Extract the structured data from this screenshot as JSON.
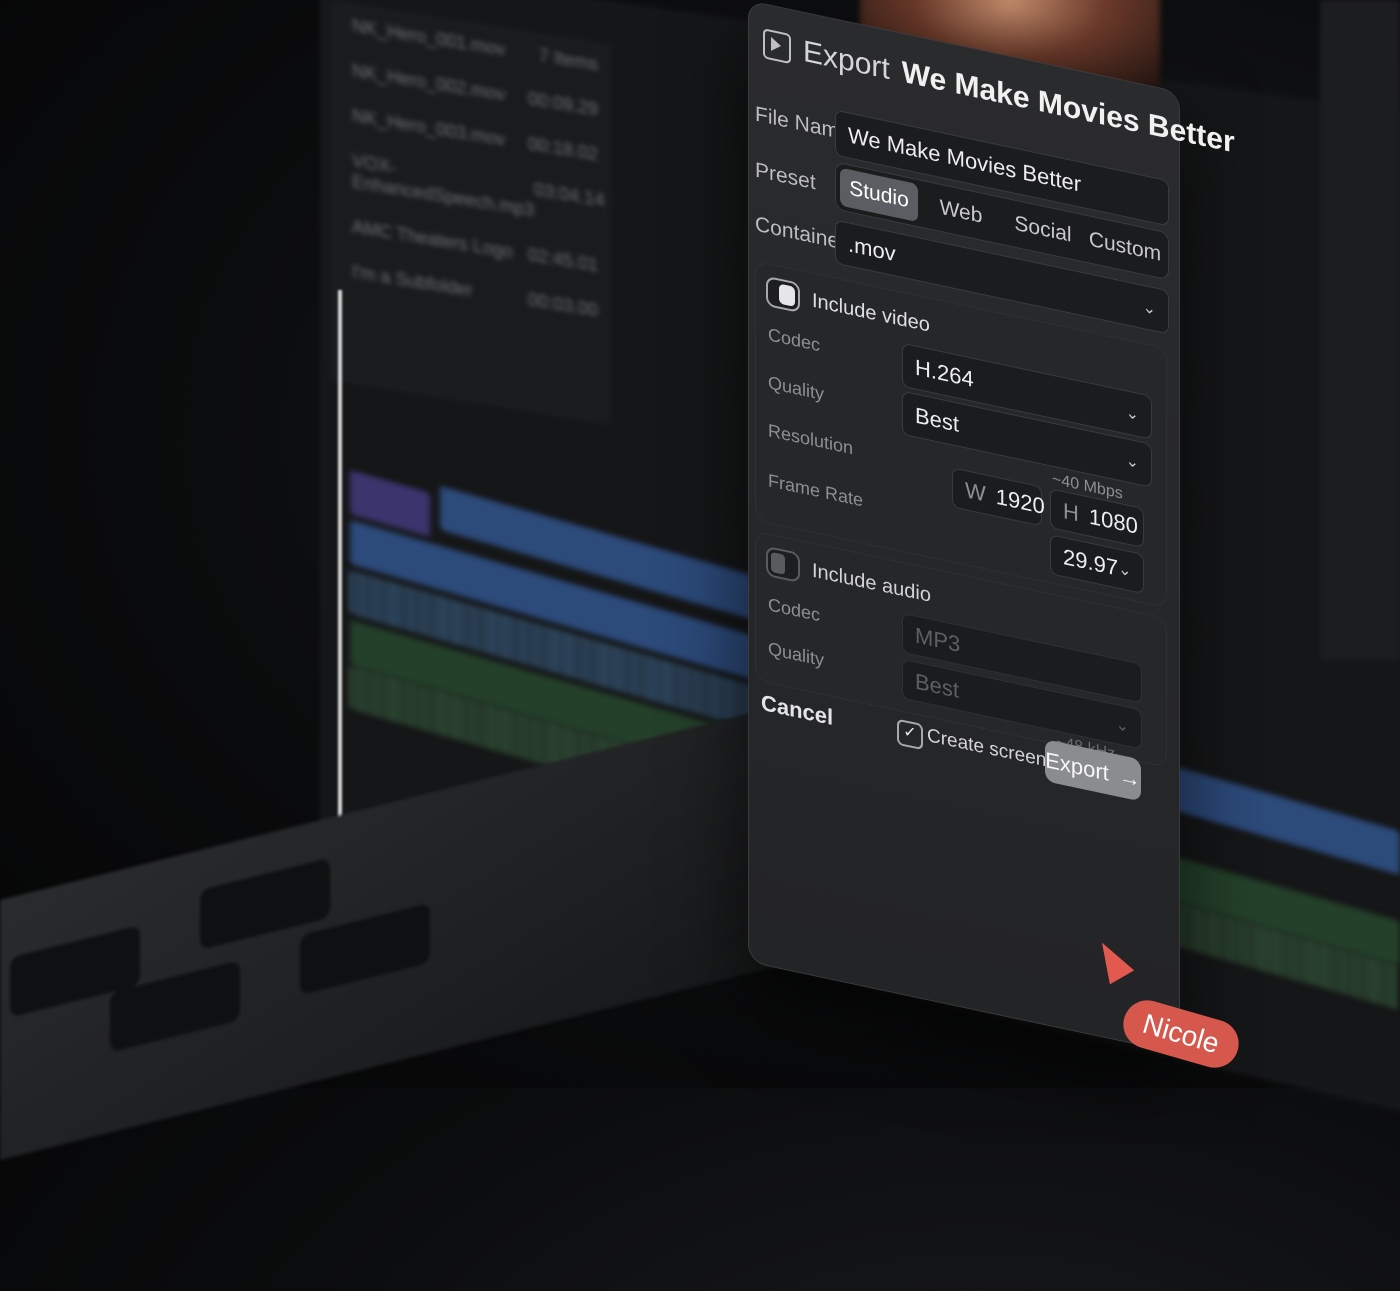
{
  "dialog": {
    "title_prefix": "Export",
    "title_name": "We Make Movies Better",
    "file_name_label": "File Name",
    "file_name_value": "We Make Movies Better",
    "preset_label": "Preset",
    "presets": [
      "Studio",
      "Web",
      "Social",
      "Custom"
    ],
    "preset_selected": "Studio",
    "container_label": "Container",
    "container_value": ".mov",
    "video": {
      "include_label": "Include video",
      "enabled": true,
      "codec_label": "Codec",
      "codec_value": "H.264",
      "quality_label": "Quality",
      "quality_value": "Best",
      "bitrate_hint": "~40 Mbps",
      "resolution_label": "Resolution",
      "width_prefix": "W",
      "width_value": "1920",
      "height_prefix": "H",
      "height_value": "1080",
      "frame_rate_label": "Frame Rate",
      "frame_rate_value": "29.97"
    },
    "audio": {
      "include_label": "Include audio",
      "enabled": false,
      "codec_label": "Codec",
      "codec_value": "MP3",
      "quality_label": "Quality",
      "quality_value": "Best",
      "sample_rate_hint": "~48 kHz"
    },
    "create_screening_label": "Create screening",
    "create_screening_checked": true,
    "cancel_label": "Cancel",
    "export_label": "Export"
  },
  "browser": {
    "rows": [
      {
        "name": "NK_Hero_001.mov",
        "meta": "7 Items"
      },
      {
        "name": "NK_Hero_002.mov",
        "meta": "00:09.29"
      },
      {
        "name": "NK_Hero_003.mov",
        "meta": "00:18.02"
      },
      {
        "name": "VOX-EnhancedSpeech.mp3",
        "meta": "03:04.14"
      },
      {
        "name": "AMC Theaters Logo",
        "meta": "02:45.01"
      },
      {
        "name": "I'm a Subfolder",
        "meta": "00:03.00"
      }
    ]
  },
  "collaborator": {
    "name": "Nicole",
    "color": "#d6584d"
  },
  "colors": {
    "accent_button": "#8b8c90",
    "dialog_bg": "#2a2b2d"
  }
}
